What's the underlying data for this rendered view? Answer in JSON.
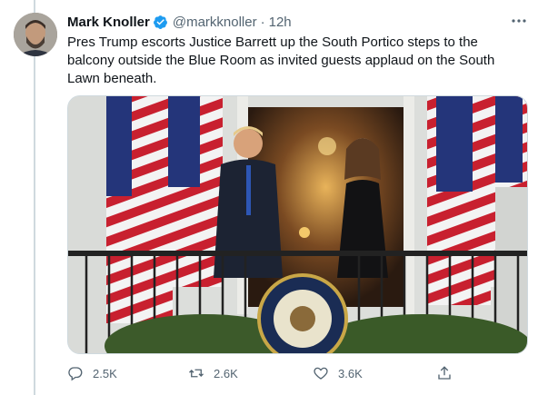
{
  "tweet": {
    "display_name": "Mark Knoller",
    "handle": "@markknoller",
    "separator": "·",
    "time": "12h",
    "text": "Pres Trump escorts Justice Barrett up the South Portico steps to the balcony outside the Blue Room as invited guests applaud on the South Lawn beneath.",
    "verified": true
  },
  "media": {
    "kind": "photo",
    "seal_text": "PRESIDENT OF THE UNITED STATES"
  },
  "actions": {
    "replies": "2.5K",
    "retweets": "2.6K",
    "likes": "3.6K"
  },
  "icons": {
    "more": "ellipsis-icon",
    "verified": "verified-badge-icon",
    "reply": "reply-icon",
    "retweet": "retweet-icon",
    "like": "heart-icon",
    "share": "share-icon"
  },
  "colors": {
    "accent": "#1d9bf0",
    "text": "#0f1419",
    "secondary": "#536471",
    "divider": "#cfd9de"
  }
}
